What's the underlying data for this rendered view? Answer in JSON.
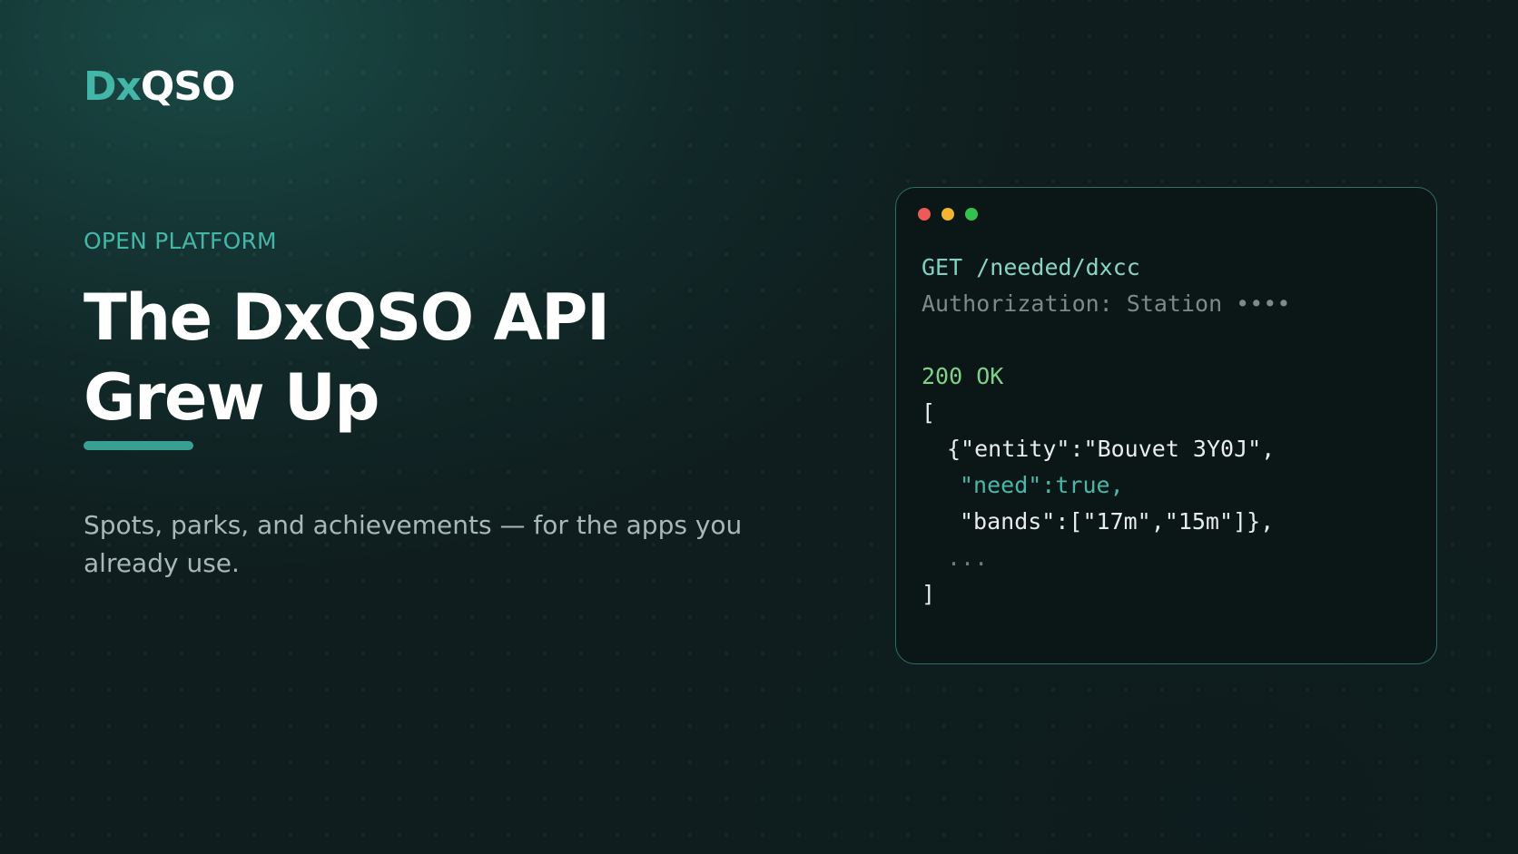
{
  "logo": {
    "part_a": "Dx",
    "part_b": "QSO"
  },
  "hero": {
    "eyebrow": "OPEN PLATFORM",
    "headline_line1": "The DxQSO API",
    "headline_line2": "Grew Up",
    "subtitle": "Spots, parks, and achievements — for the apps you already use."
  },
  "terminal": {
    "request_method": "GET",
    "request_path": "/needed/dxcc",
    "auth_header": "Authorization: Station ••••",
    "status": "200 OK",
    "lines": {
      "open_bracket": "[",
      "entity": "{\"entity\":\"Bouvet 3Y0J\",",
      "need": "\"need\":true,",
      "bands": "\"bands\":[\"17m\",\"15m\"]},",
      "ellipsis": "...",
      "close_bracket": "]"
    }
  },
  "colors": {
    "accent": "#43b6a8",
    "background": "#0f1d1e",
    "terminal_bg": "#0b1717",
    "status_ok": "#7fd08a"
  }
}
